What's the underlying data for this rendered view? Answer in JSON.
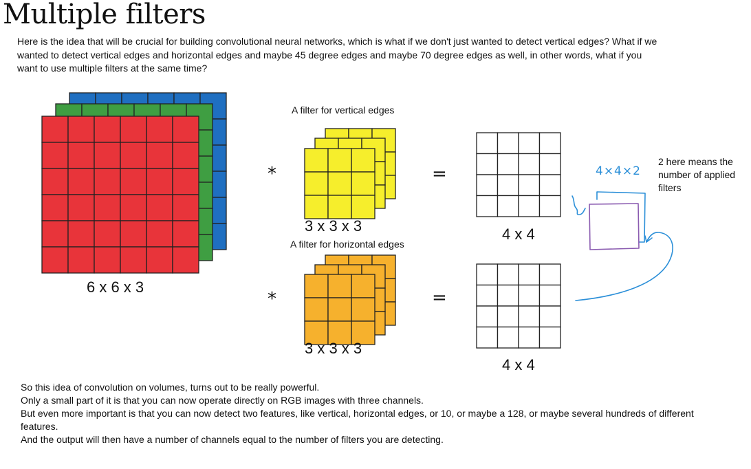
{
  "title": "Multiple filters",
  "intro": "Here is the idea that will be crucial for building convolutional neural networks, which is what if we don't just wanted to detect vertical edges? What if we wanted to detect vertical edges and horizontal edges and maybe 45 degree edges and maybe 70 degree edges as well, in other words, what if you want to use multiple filters at the same time?",
  "diagram": {
    "input_dim": "6 x 6 x 3",
    "filter_vertical_label": "A filter for vertical edges",
    "filter_horizontal_label": "A filter for horizontal edges",
    "filter1_dim": "3 x 3 x 3",
    "filter2_dim": "3 x 3 x 3",
    "output1_dim": "4 x 4",
    "output2_dim": "4 x 4",
    "conv_op": "*",
    "equals_op": "=",
    "handwritten_dim": "4×4×2",
    "note": "2 here means the number of applied filters",
    "colors": {
      "red": "#e8343a",
      "green": "#3f9e42",
      "blue": "#1f6fc1",
      "yellow": "#f6ee2c",
      "orange": "#f6b12d",
      "annotation": "#2b8fd8",
      "annotation_purple": "#8a5bb0"
    }
  },
  "outro": [
    "So this idea of convolution on volumes, turns out to be really powerful.",
    "Only a small part of it is that you can now operate directly on RGB images with three channels.",
    "But even more important is that you can now detect two features, like vertical, horizontal edges, or 10, or maybe a 128, or maybe several hundreds of different features.",
    "And the output will then have a number of channels equal to the number of filters you are detecting."
  ]
}
